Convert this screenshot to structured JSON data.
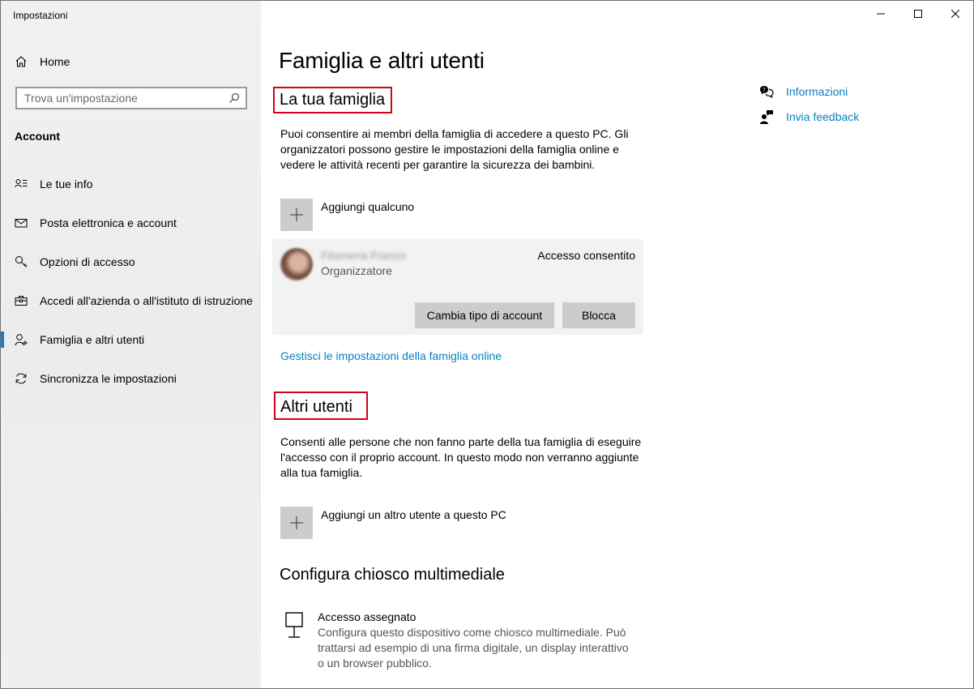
{
  "window": {
    "title": "Impostazioni"
  },
  "sidebar": {
    "home_label": "Home",
    "search_placeholder": "Trova un'impostazione",
    "section_label": "Account",
    "items": [
      {
        "label": "Le tue info",
        "icon": "user-info-icon"
      },
      {
        "label": "Posta elettronica e account",
        "icon": "mail-icon"
      },
      {
        "label": "Opzioni di accesso",
        "icon": "key-icon"
      },
      {
        "label": "Accedi all'azienda o all'istituto di istruzione",
        "icon": "briefcase-icon"
      },
      {
        "label": "Famiglia e altri utenti",
        "icon": "person-add-icon",
        "active": true
      },
      {
        "label": "Sincronizza le impostazioni",
        "icon": "sync-icon"
      }
    ]
  },
  "main": {
    "page_title": "Famiglia e altri utenti",
    "family": {
      "heading": "La tua famiglia",
      "description_lines": [
        "Puoi consentire ai membri della famiglia di accedere a questo PC. Gli",
        "organizzatori possono gestire le impostazioni della famiglia online e",
        "vedere le attività recenti per garantire la sicurezza dei bambini."
      ],
      "add_label": "Aggiungi qualcuno",
      "member": {
        "name": "Filomena Franco",
        "role": "Organizzatore",
        "status": "Accesso consentito",
        "change_type_button": "Cambia tipo di account",
        "block_button": "Blocca"
      },
      "manage_link": "Gestisci le impostazioni della famiglia online"
    },
    "other_users": {
      "heading": "Altri utenti",
      "description_lines": [
        "Consenti alle persone che non fanno parte della tua famiglia di eseguire",
        "l'accesso con il proprio account. In questo modo non verranno aggiunte",
        "alla tua famiglia."
      ],
      "add_label": "Aggiungi un altro utente a questo PC"
    },
    "kiosk": {
      "heading": "Configura chiosco multimediale",
      "item_title": "Accesso assegnato",
      "item_description_lines": [
        "Configura questo dispositivo come chiosco multimediale. Può",
        "trattarsi ad esempio di una firma digitale, un display interattivo",
        "o un browser pubblico."
      ]
    }
  },
  "aside": {
    "links": [
      {
        "label": "Informazioni",
        "icon": "help-chat-icon"
      },
      {
        "label": "Invia feedback",
        "icon": "feedback-icon"
      }
    ]
  },
  "colors": {
    "accent": "#1e7bd4",
    "link": "#0a7fbf",
    "highlight_box": "#d6001c"
  }
}
